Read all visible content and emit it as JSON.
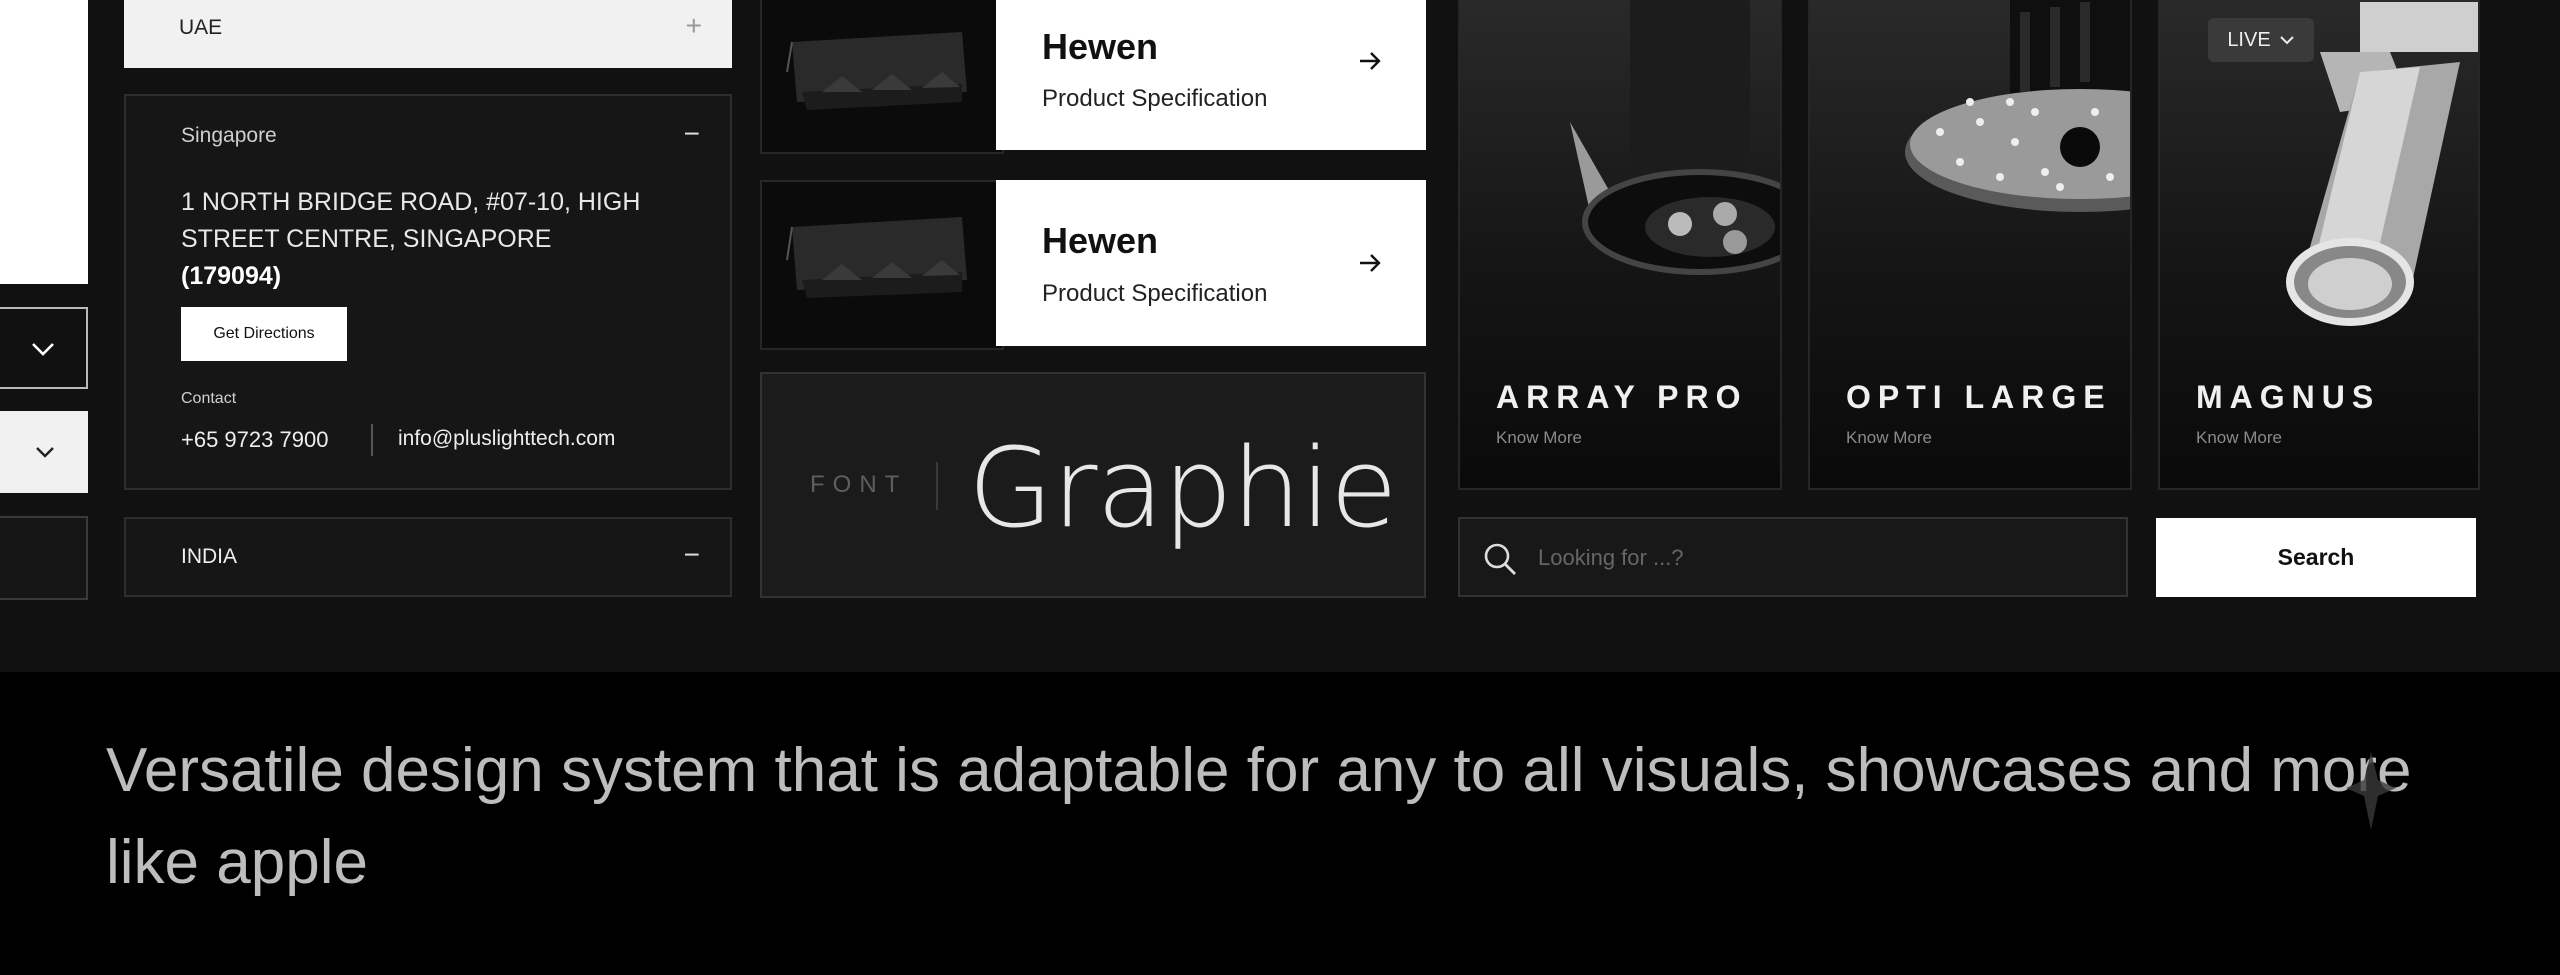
{
  "accordion": {
    "uae": {
      "title": "UAE",
      "icon": "+"
    },
    "singapore": {
      "title": "Singapore",
      "icon": "−",
      "address_line1": "1 NORTH BRIDGE ROAD, #07-10, HIGH",
      "address_line2": "STREET CENTRE, SINGAPORE",
      "postal": "(179094)",
      "directions_label": "Get Directions",
      "contact_label": "Contact",
      "phone": "+65 9723 7900",
      "email": "info@pluslighttech.com"
    },
    "india": {
      "title": "INDIA",
      "icon": "−"
    }
  },
  "spec_cards": [
    {
      "title": "Hewen",
      "subtitle": "Product Specification"
    },
    {
      "title": "Hewen",
      "subtitle": "Product Specification"
    }
  ],
  "font_sample": {
    "label": "FONT",
    "name": "Graphie"
  },
  "products": [
    {
      "name": "ARRAY PRO",
      "link": "Know More"
    },
    {
      "name": "OPTI LARGE",
      "link": "Know More"
    },
    {
      "name": "MAGNUS",
      "link": "Know More"
    }
  ],
  "live_badge": "LIVE",
  "search": {
    "placeholder": "Looking for ...?",
    "button_label": "Search"
  },
  "caption": "Versatile design system that is adaptable for any to all visuals, showcases and more like apple",
  "colors": {
    "board": "#111111",
    "caption_bg": "#000000",
    "caption_text": "#bdbdbd",
    "card": "#ffffff"
  }
}
